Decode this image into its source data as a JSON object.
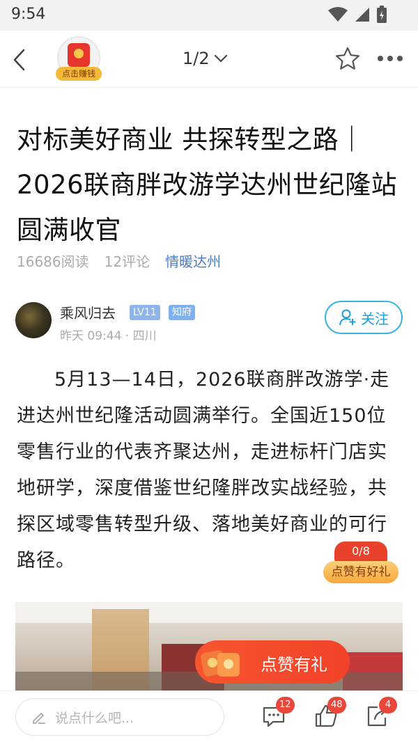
{
  "status_bar": {
    "time": "9:54"
  },
  "nav": {
    "promo_label": "点击赚钱",
    "page_indicator": "1/2"
  },
  "article": {
    "headline": "对标美好商业 共探转型之路｜2026联商胖改游学达州世纪隆站圆满收官",
    "reads": "16686阅读",
    "comments": "12评论",
    "topic": "情暖达州",
    "body": "5月13—14日，2026联商胖改游学·走进达州世纪隆活动圆满举行。全国近150位零售行业的代表齐聚达州，走进标杆门店实地研学，深度借鉴世纪隆胖改实战经验，共探区域零售转型升级、落地美好商业的可行路径。"
  },
  "author": {
    "name": "乘风归去",
    "level_badge": "LV11",
    "role_badge": "知府",
    "time_location": "昨天 09:44 · 四川",
    "follow_label": "关注"
  },
  "reward": {
    "count": "0/8",
    "label": "点赞有好礼"
  },
  "like_banner": {
    "label": "点赞有礼"
  },
  "bottom_bar": {
    "comment_placeholder": "说点什么吧...",
    "comment_count": "12",
    "like_count": "48",
    "share_count": "4"
  },
  "colors": {
    "accent_blue": "#3ab3e6",
    "topic_blue": "#4a7cc7",
    "promo_red": "#f3422a",
    "badge_red": "#e8473a"
  }
}
